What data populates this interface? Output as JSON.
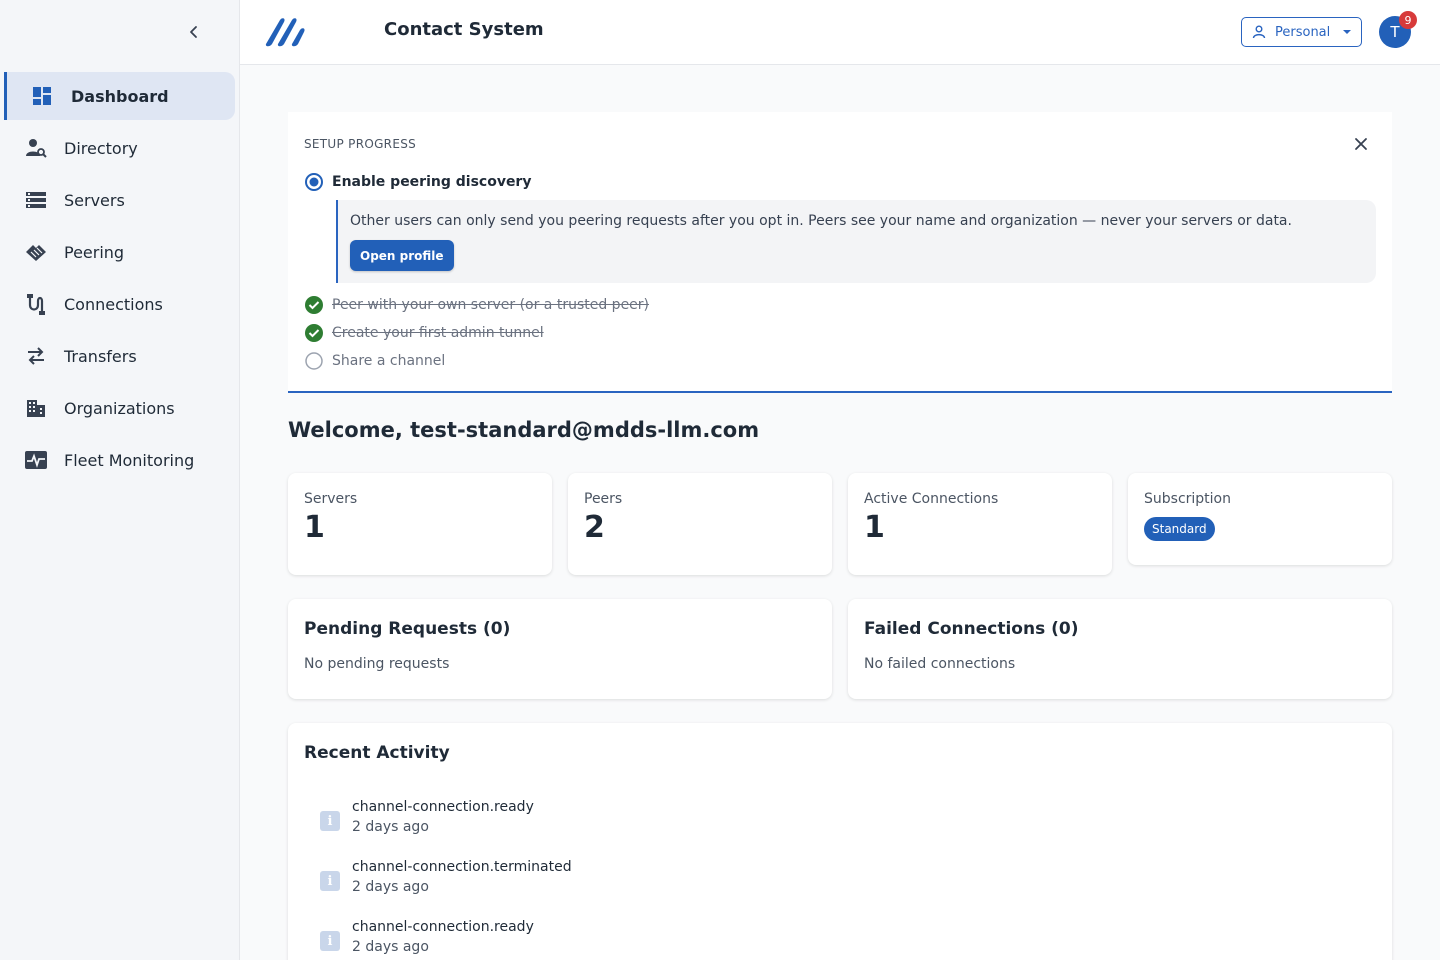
{
  "app": {
    "title": "Contact System"
  },
  "header": {
    "workspace_label": "Personal",
    "avatar_initial": "T",
    "notification_count": "9"
  },
  "sidebar": {
    "items": [
      {
        "label": "Dashboard",
        "icon": "dashboard-icon",
        "active": true
      },
      {
        "label": "Directory",
        "icon": "person-search-icon"
      },
      {
        "label": "Servers",
        "icon": "server-list-icon"
      },
      {
        "label": "Peering",
        "icon": "peering-icon"
      },
      {
        "label": "Connections",
        "icon": "connections-icon"
      },
      {
        "label": "Transfers",
        "icon": "transfer-arrows-icon"
      },
      {
        "label": "Organizations",
        "icon": "building-icon"
      },
      {
        "label": "Fleet Monitoring",
        "icon": "monitoring-icon"
      }
    ]
  },
  "setup": {
    "label": "SETUP PROGRESS",
    "steps": [
      {
        "label": "Enable peering discovery",
        "state": "current"
      },
      {
        "label": "Peer with your own server (or a trusted peer)",
        "state": "done"
      },
      {
        "label": "Create your first admin tunnel",
        "state": "done"
      },
      {
        "label": "Share a channel",
        "state": "todo"
      }
    ],
    "help_text": "Other users can only send you peering requests after you opt in. Peers see your name and organization — never your servers or data.",
    "open_profile_label": "Open profile"
  },
  "welcome": "Welcome, test-standard@mdds-llm.com",
  "stats": {
    "servers": {
      "label": "Servers",
      "value": "1"
    },
    "peers": {
      "label": "Peers",
      "value": "2"
    },
    "active_connections": {
      "label": "Active Connections",
      "value": "1"
    },
    "subscription": {
      "label": "Subscription",
      "value": "Standard"
    }
  },
  "pending": {
    "title": "Pending Requests (0)",
    "empty": "No pending requests"
  },
  "failed": {
    "title": "Failed Connections (0)",
    "empty": "No failed connections"
  },
  "activity": {
    "title": "Recent Activity",
    "items": [
      {
        "name": "channel-connection.ready",
        "time": "2 days ago"
      },
      {
        "name": "channel-connection.terminated",
        "time": "2 days ago"
      },
      {
        "name": "channel-connection.ready",
        "time": "2 days ago"
      }
    ]
  },
  "colors": {
    "primary": "#2260b8",
    "success": "#2e7d32",
    "notification": "#d73a3a"
  }
}
